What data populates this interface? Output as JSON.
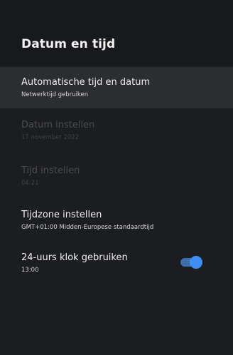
{
  "screen": {
    "title": "Datum en tijd"
  },
  "settings": [
    {
      "title": "Automatische tijd en datum",
      "subtitle": "Netwerktijd gebruiken",
      "state": "focused"
    },
    {
      "title": "Datum instellen",
      "subtitle": "17 november 2022",
      "state": "disabled"
    },
    {
      "title": "Tijd instellen",
      "subtitle": "04:21",
      "state": "disabled"
    },
    {
      "title": "Tijdzone instellen",
      "subtitle": "GMT+01:00 Midden-Europese standaardtijd",
      "state": "enabled"
    },
    {
      "title": "24-uurs klok gebruiken",
      "subtitle": "13:00",
      "state": "enabled",
      "toggle_on": true
    }
  ],
  "colors": {
    "background": "#1c1d20",
    "focused_row": "#2c2d30",
    "toggle_track": "#3f6fa8",
    "toggle_knob": "#3d8ef2",
    "disabled_text": "#4a4b4e"
  }
}
